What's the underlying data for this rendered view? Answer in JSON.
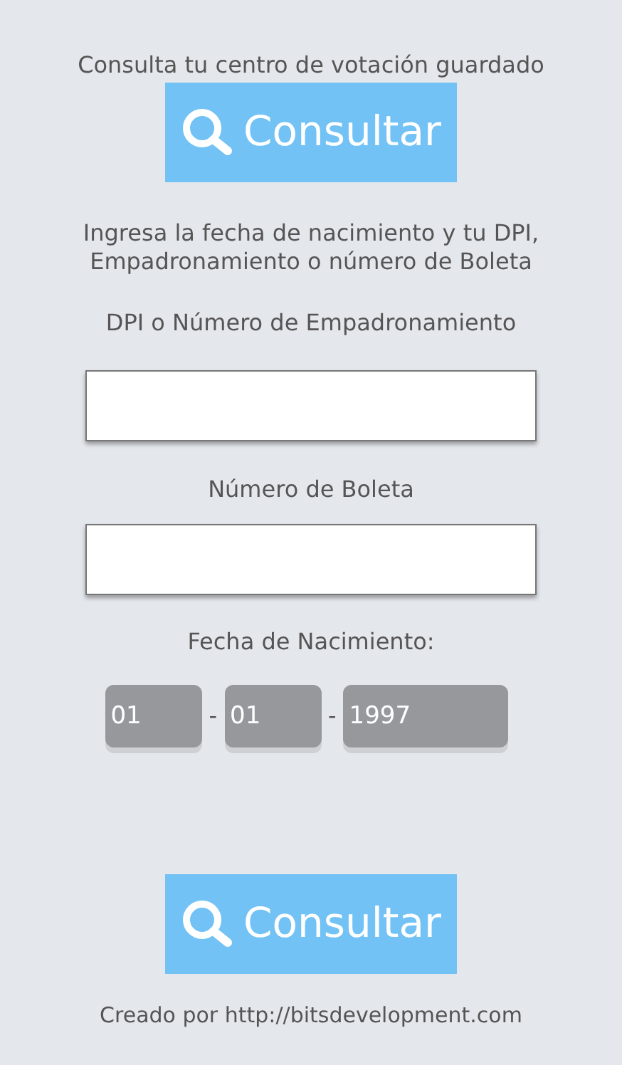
{
  "saved_prompt": "Consulta tu centro de votación guardado",
  "saved_button": {
    "label": "Consultar"
  },
  "instructions": [
    "Ingresa la fecha de nacimiento y tu DPI,",
    "Empadronamiento o número de Boleta"
  ],
  "fields": [
    {
      "label": "DPI o Número de Empadronamiento"
    },
    {
      "label": "Número de Boleta"
    }
  ],
  "birth_date": {
    "label": "Fecha de Nacimiento:",
    "separator": "-",
    "day": "01",
    "month": "01",
    "year": "1997"
  },
  "submit_button": {
    "label": "Consultar"
  },
  "footer": "Creado por http://bitsdevelopment.com"
}
